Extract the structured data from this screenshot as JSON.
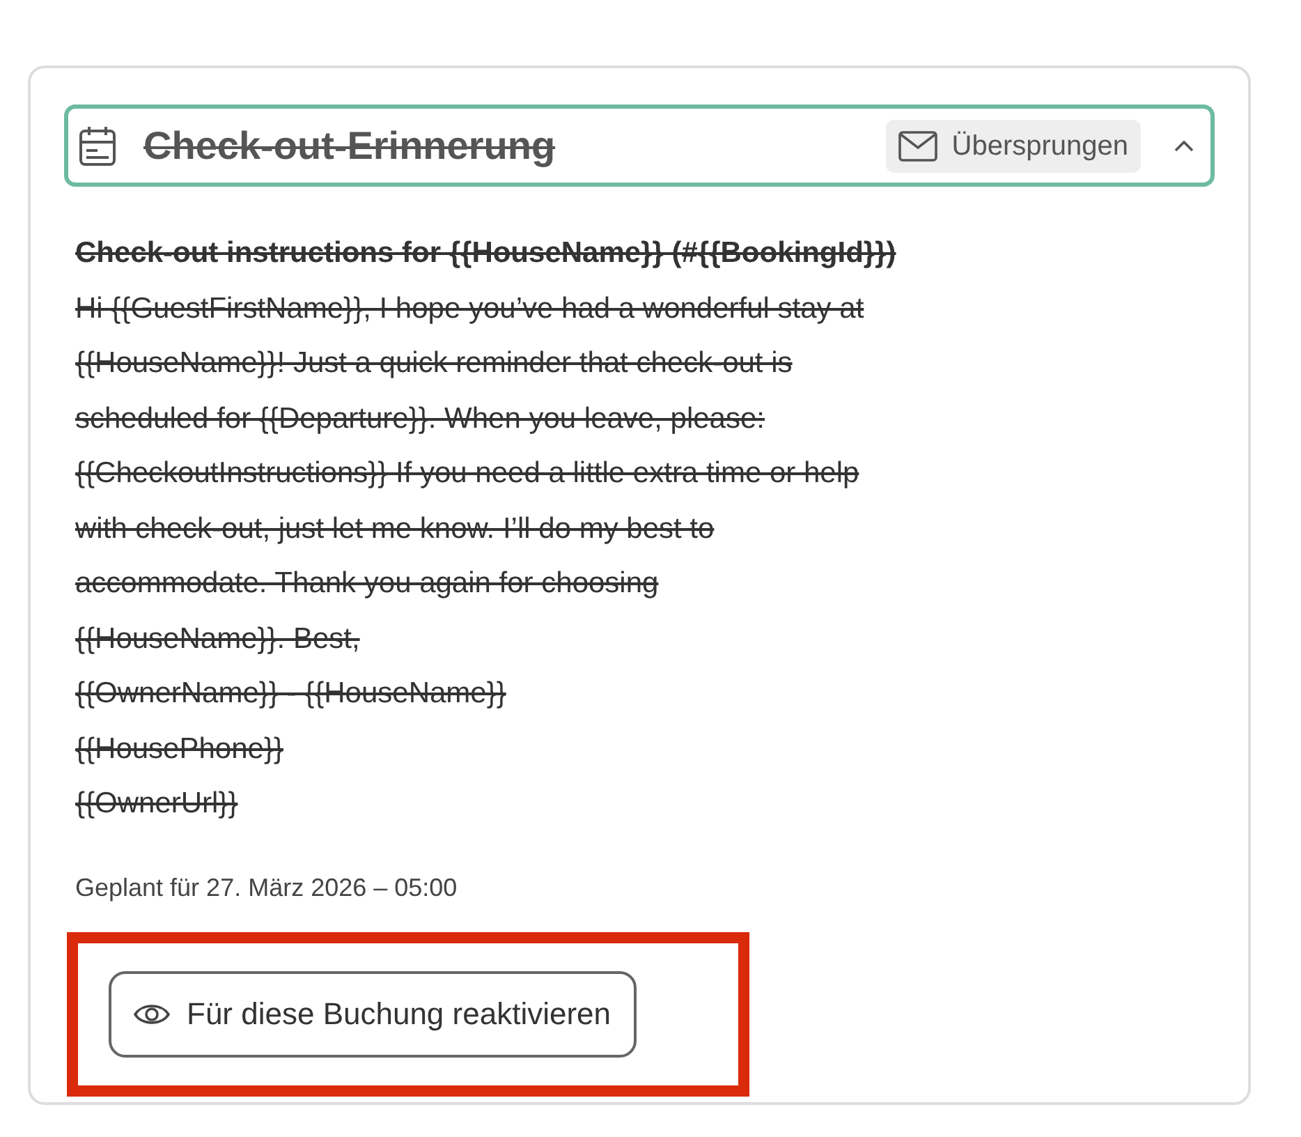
{
  "card": {
    "title": "Check-out-Erinnerung",
    "title_struck": true,
    "status": "Übersprungen",
    "expanded": true,
    "subject": "Check-out instructions for {{HouseName}} (#{{BookingId}})",
    "body_struck": true,
    "body_lines": [
      "Hi {{GuestFirstName}}, I hope you’ve had a wonderful stay at",
      "{{HouseName}}! Just a quick reminder that check-out is",
      "scheduled for {{Departure}}. When you leave, please:",
      "{{CheckoutInstructions}} If you need a little extra time or help",
      "with check-out, just let me know. I’ll do my best to",
      "accommodate. Thank you again for choosing",
      "{{HouseName}}. Best,",
      "{{OwnerName}} - {{HouseName}}",
      "{{HousePhone}}",
      "{{OwnerUrl}}"
    ],
    "schedule": "Geplant für 27. März 2026 – 05:00",
    "action": {
      "label": "Für diese Buchung reaktivieren",
      "highlighted": true
    }
  }
}
